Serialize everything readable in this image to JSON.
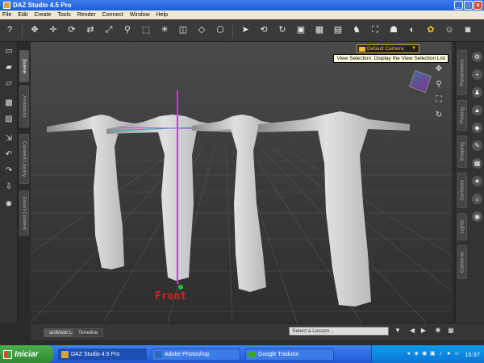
{
  "window": {
    "title": "DAZ Studio 4.5 Pro"
  },
  "menu": [
    "File",
    "Edit",
    "Create",
    "Tools",
    "Render",
    "Connect",
    "Window",
    "Help"
  ],
  "toolbar_icons": [
    "help-pointer-icon",
    "pose-tool-icon",
    "universal-tool-icon",
    "rotate-tool-icon",
    "translate-tool-icon",
    "scale-tool-icon",
    "joint-editor-icon",
    "region-nav-icon",
    "light-tool-icon",
    "camera-tool-icon",
    "select-arrow-icon",
    "orbit-icon",
    "spin-icon",
    "frame-icon",
    "render-icon",
    "preview-render-icon",
    "figure-icon",
    "geometry-editor-icon",
    "morph-icon",
    "smooth-icon",
    "gear-icon",
    "camera-icon"
  ],
  "left_tabs": [
    "Scene",
    "Aniblocks",
    "Content Library",
    "Smart Content"
  ],
  "right_tabs": [
    "Parameters",
    "Posing",
    "Shaping",
    "Surfaces",
    "Lights",
    "Cameras"
  ],
  "viewport": {
    "camera_label": "Default Camera",
    "tooltip": "View Selection: Display the View Selection List",
    "view_label": "Front"
  },
  "bottom": {
    "tabs": [
      "aniMate Lite",
      "Timeline"
    ],
    "lesson_placeholder": "Select a Lesson..."
  },
  "taskbar": {
    "start_label": "Iniciar",
    "items": [
      "DAZ Studio 4.5 Pro",
      "Adobe Photoshop",
      "Google Tradutor"
    ],
    "clock": "15:37"
  },
  "colors": {
    "accent": "#f0c030",
    "front_label": "#e02020",
    "taskbar": "#1f57d1"
  }
}
